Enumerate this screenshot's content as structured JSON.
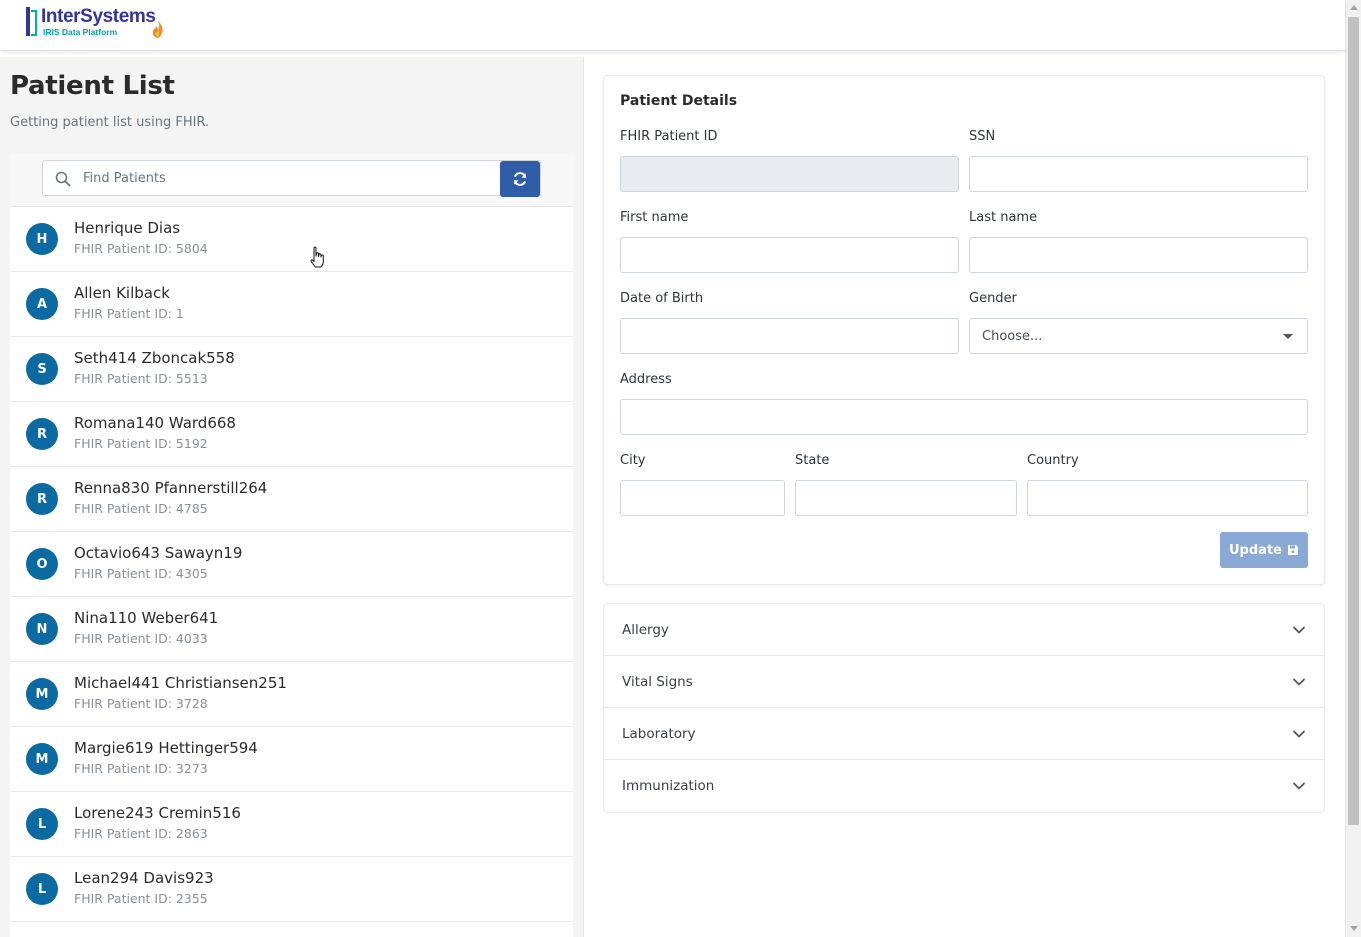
{
  "header": {
    "logo_name": "InterSystems",
    "logo_sub": "IRIS Data Platform"
  },
  "left": {
    "title": "Patient List",
    "subtitle": "Getting patient list using FHIR.",
    "search": {
      "placeholder": "Find Patients",
      "value": ""
    },
    "patients": [
      {
        "initial": "H",
        "name": "Henrique Dias",
        "id_text": "FHIR Patient ID: 5804"
      },
      {
        "initial": "A",
        "name": "Allen Kilback",
        "id_text": "FHIR Patient ID: 1"
      },
      {
        "initial": "S",
        "name": "Seth414 Zboncak558",
        "id_text": "FHIR Patient ID: 5513"
      },
      {
        "initial": "R",
        "name": "Romana140 Ward668",
        "id_text": "FHIR Patient ID: 5192"
      },
      {
        "initial": "R",
        "name": "Renna830 Pfannerstill264",
        "id_text": "FHIR Patient ID: 4785"
      },
      {
        "initial": "O",
        "name": "Octavio643 Sawayn19",
        "id_text": "FHIR Patient ID: 4305"
      },
      {
        "initial": "N",
        "name": "Nina110 Weber641",
        "id_text": "FHIR Patient ID: 4033"
      },
      {
        "initial": "M",
        "name": "Michael441 Christiansen251",
        "id_text": "FHIR Patient ID: 3728"
      },
      {
        "initial": "M",
        "name": "Margie619 Hettinger594",
        "id_text": "FHIR Patient ID: 3273"
      },
      {
        "initial": "L",
        "name": "Lorene243 Cremin516",
        "id_text": "FHIR Patient ID: 2863"
      },
      {
        "initial": "L",
        "name": "Lean294 Davis923",
        "id_text": "FHIR Patient ID: 2355"
      }
    ]
  },
  "details": {
    "title": "Patient Details",
    "fhir_id_label": "FHIR Patient ID",
    "ssn_label": "SSN",
    "first_name_label": "First name",
    "last_name_label": "Last name",
    "dob_label": "Date of Birth",
    "gender_label": "Gender",
    "gender_value": "Choose...",
    "address_label": "Address",
    "city_label": "City",
    "state_label": "State",
    "country_label": "Country",
    "update_label": "Update"
  },
  "accordion": {
    "items": [
      {
        "label": "Allergy"
      },
      {
        "label": "Vital Signs"
      },
      {
        "label": "Laboratory"
      },
      {
        "label": "Immunization"
      }
    ]
  },
  "colors": {
    "primary": "#2f5da8",
    "avatar": "#0b6aa2",
    "update_disabled": "#8aa9d4",
    "logo_navy": "#333695",
    "logo_teal": "#00b2a9"
  }
}
